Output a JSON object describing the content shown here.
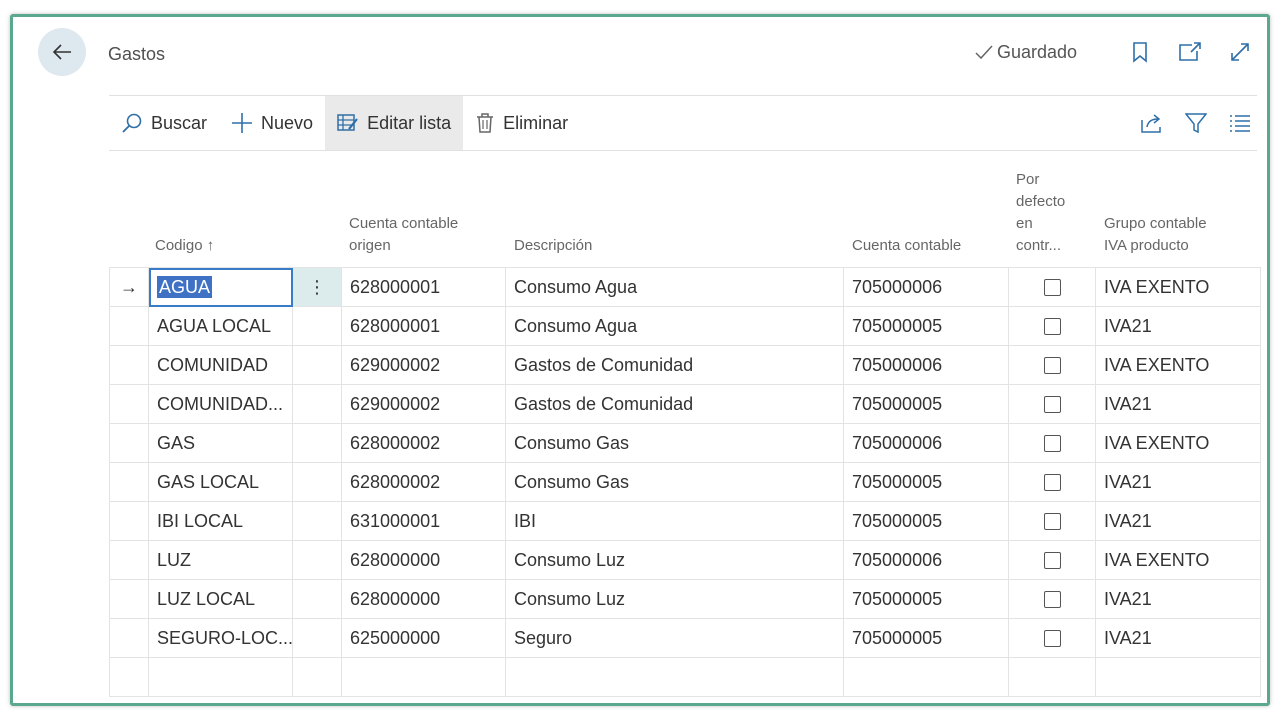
{
  "header": {
    "title": "Gastos",
    "saved_label": "Guardado",
    "icons": [
      "back-arrow-icon",
      "checkmark-icon",
      "bookmark-icon",
      "open-new-window-icon",
      "expand-icon"
    ]
  },
  "actions": {
    "search": "Buscar",
    "new": "Nuevo",
    "edit_list": "Editar lista",
    "delete": "Eliminar"
  },
  "columns": {
    "codigo": "Codigo",
    "sort_indicator": "↑",
    "cuenta_origen_line1": "Cuenta contable",
    "cuenta_origen_line2": "origen",
    "descripcion": "Descripción",
    "cuenta_contable": "Cuenta contable",
    "por_defecto_l1": "Por",
    "por_defecto_l2": "defecto",
    "por_defecto_l3": "en",
    "por_defecto_l4": "contr...",
    "grupo_l1": "Grupo contable",
    "grupo_l2": "IVA producto"
  },
  "rows": [
    {
      "codigo": "AGUA",
      "origen": "628000001",
      "descripcion": "Consumo Agua",
      "cuenta": "705000006",
      "defecto": false,
      "iva": "IVA EXENTO"
    },
    {
      "codigo": "AGUA LOCAL",
      "origen": "628000001",
      "descripcion": "Consumo Agua",
      "cuenta": "705000005",
      "defecto": false,
      "iva": "IVA21"
    },
    {
      "codigo": "COMUNIDAD",
      "origen": "629000002",
      "descripcion": "Gastos de Comunidad",
      "cuenta": "705000006",
      "defecto": false,
      "iva": "IVA EXENTO"
    },
    {
      "codigo": "COMUNIDAD...",
      "origen": "629000002",
      "descripcion": "Gastos de Comunidad",
      "cuenta": "705000005",
      "defecto": false,
      "iva": "IVA21"
    },
    {
      "codigo": "GAS",
      "origen": "628000002",
      "descripcion": "Consumo Gas",
      "cuenta": "705000006",
      "defecto": false,
      "iva": "IVA EXENTO"
    },
    {
      "codigo": "GAS LOCAL",
      "origen": "628000002",
      "descripcion": "Consumo Gas",
      "cuenta": "705000005",
      "defecto": false,
      "iva": "IVA21"
    },
    {
      "codigo": "IBI LOCAL",
      "origen": "631000001",
      "descripcion": "IBI",
      "cuenta": "705000005",
      "defecto": false,
      "iva": "IVA21"
    },
    {
      "codigo": "LUZ",
      "origen": "628000000",
      "descripcion": "Consumo Luz",
      "cuenta": "705000006",
      "defecto": false,
      "iva": "IVA EXENTO"
    },
    {
      "codigo": "LUZ LOCAL",
      "origen": "628000000",
      "descripcion": "Consumo Luz",
      "cuenta": "705000005",
      "defecto": false,
      "iva": "IVA21"
    },
    {
      "codigo": "SEGURO-LOC...",
      "origen": "625000000",
      "descripcion": "Seguro",
      "cuenta": "705000005",
      "defecto": false,
      "iva": "IVA21"
    }
  ],
  "selected_row_indicator": "→",
  "row_menu_glyph": "⋮"
}
